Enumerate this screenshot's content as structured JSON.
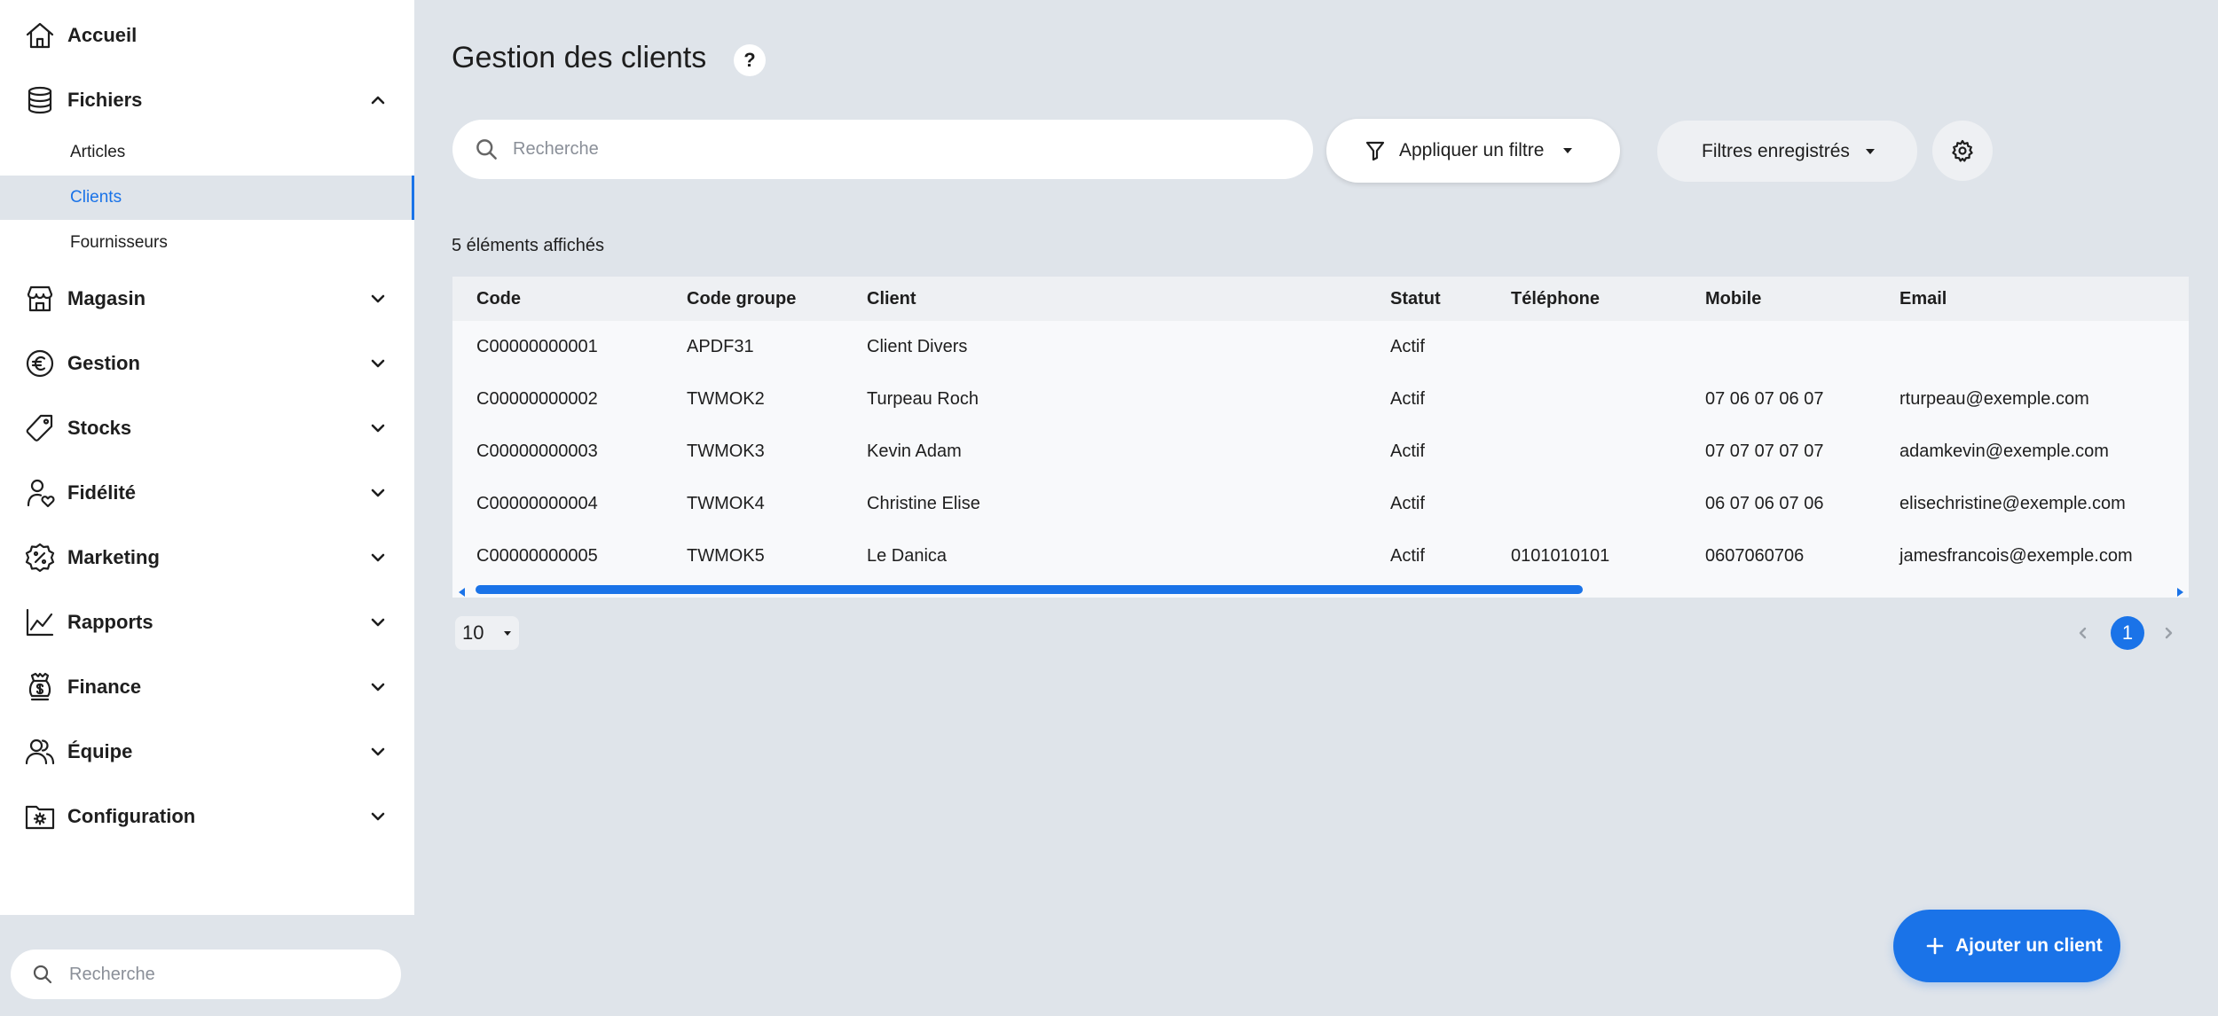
{
  "sidebar": {
    "nav": [
      {
        "label": "Accueil",
        "icon": "home-icon",
        "expandable": false
      },
      {
        "label": "Fichiers",
        "icon": "database-icon",
        "expandable": true,
        "expanded": true
      },
      {
        "label": "Magasin",
        "icon": "store-icon",
        "expandable": true,
        "expanded": false
      },
      {
        "label": "Gestion",
        "icon": "euro-icon",
        "expandable": true,
        "expanded": false
      },
      {
        "label": "Stocks",
        "icon": "tag-icon",
        "expandable": true,
        "expanded": false
      },
      {
        "label": "Fidélité",
        "icon": "user-heart-icon",
        "expandable": true,
        "expanded": false
      },
      {
        "label": "Marketing",
        "icon": "discount-badge-icon",
        "expandable": true,
        "expanded": false
      },
      {
        "label": "Rapports",
        "icon": "line-chart-icon",
        "expandable": true,
        "expanded": false
      },
      {
        "label": "Finance",
        "icon": "money-icon",
        "expandable": true,
        "expanded": false
      },
      {
        "label": "Équipe",
        "icon": "team-icon",
        "expandable": true,
        "expanded": false
      },
      {
        "label": "Configuration",
        "icon": "folder-gear-icon",
        "expandable": true,
        "expanded": false
      }
    ],
    "sub_items": [
      {
        "label": "Articles",
        "active": false
      },
      {
        "label": "Clients",
        "active": true
      },
      {
        "label": "Fournisseurs",
        "active": false
      }
    ],
    "search_placeholder": "Recherche"
  },
  "main": {
    "title": "Gestion des clients",
    "help_label": "?",
    "search_placeholder": "Recherche",
    "filter_label": "Appliquer un filtre",
    "saved_filters_label": "Filtres enregistrés",
    "count_label": "5 éléments affichés"
  },
  "table": {
    "columns": [
      "Code",
      "Code groupe",
      "Client",
      "Statut",
      "Téléphone",
      "Mobile",
      "Email"
    ],
    "rows": [
      [
        "C00000000001",
        "APDF31",
        "Client Divers",
        "Actif",
        "",
        "",
        ""
      ],
      [
        "C00000000002",
        "TWMOK2",
        "Turpeau Roch",
        "Actif",
        "",
        "07 06 07 06 07",
        "rturpeau@exemple.com"
      ],
      [
        "C00000000003",
        "TWMOK3",
        "Kevin Adam",
        "Actif",
        "",
        "07 07 07 07 07",
        "adamkevin@exemple.com"
      ],
      [
        "C00000000004",
        "TWMOK4",
        "Christine Elise",
        "Actif",
        "",
        "06 07 06 07 06",
        "elisechristine@exemple.com"
      ],
      [
        "C00000000005",
        "TWMOK5",
        "Le Danica",
        "Actif",
        "0101010101",
        "0607060706",
        "jamesfrancois@exemple.com"
      ]
    ]
  },
  "pagination": {
    "page_size": "10",
    "current_page": "1"
  },
  "fab": {
    "label": "Ajouter un client"
  },
  "colors": {
    "accent": "#1a73e8",
    "background": "#dfe4ea",
    "surface": "#ffffff"
  }
}
